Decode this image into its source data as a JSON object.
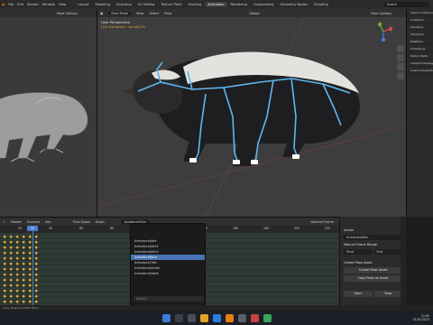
{
  "menubar": {
    "items": [
      "File",
      "Edit",
      "Render",
      "Window",
      "Help"
    ],
    "workspaces": [
      "Layout",
      "Modeling",
      "Sculpting",
      "UV Editing",
      "Texture Paint",
      "Shading",
      "Animation",
      "Rendering",
      "Compositing",
      "Geometry Nodes",
      "Scripting"
    ],
    "active_workspace": "Animation",
    "scene": "Scene"
  },
  "left_viewport": {
    "header": "Pose Options"
  },
  "main_viewport": {
    "mode": "Pose Mode",
    "menus": [
      "View",
      "Select",
      "Pose"
    ],
    "transform": "Global",
    "view_label": "User Perspective",
    "context_label": "(25) Armature : tarsal(13)",
    "pose_options": "Pose Options"
  },
  "right_panel": {
    "rows": [
      "Scene Collection",
      "Collection",
      "Armature",
      "Transform",
      "Relations",
      "Collections",
      "Motion Paths",
      "Viewport Display",
      "Custom Properties"
    ]
  },
  "dope_sheet": {
    "menus": [
      "Marker",
      "Channel",
      "Key"
    ],
    "push_down": "Push Down",
    "stash": "Stash",
    "action": "Armature|Run",
    "frame_ticks": [
      "20",
      "40",
      "60",
      "80",
      "100",
      "120",
      "140",
      "160",
      "180",
      "200",
      "220"
    ],
    "current_frame": "25",
    "keyed_frame": "Nearest Frame"
  },
  "action_popup": {
    "items": [
      "Armature|Idle",
      "Armature|Idle1",
      "Armature|Idle2",
      "Armature|Run",
      "Armature|Trot",
      "Armature|Smell",
      "Armature|Walk"
    ],
    "selected": "Armature|Run",
    "search_placeholder": "Search"
  },
  "pose_panel": {
    "section_action": "Action",
    "action_value": "Armature|Run",
    "manual_frame_range": "Manual Frame Range",
    "start": "Start",
    "end": "End",
    "create_section": "Create Pose Asset",
    "create_button": "Create Pose Asset",
    "copy_button": "Copy Pose as Asset",
    "bottom_buttons": [
      "Start",
      "Stop"
    ]
  },
  "statusbar": {
    "text": "Copy Shape Context Menu"
  },
  "taskbar": {
    "time": "12:00",
    "date": "01/01/2023"
  }
}
